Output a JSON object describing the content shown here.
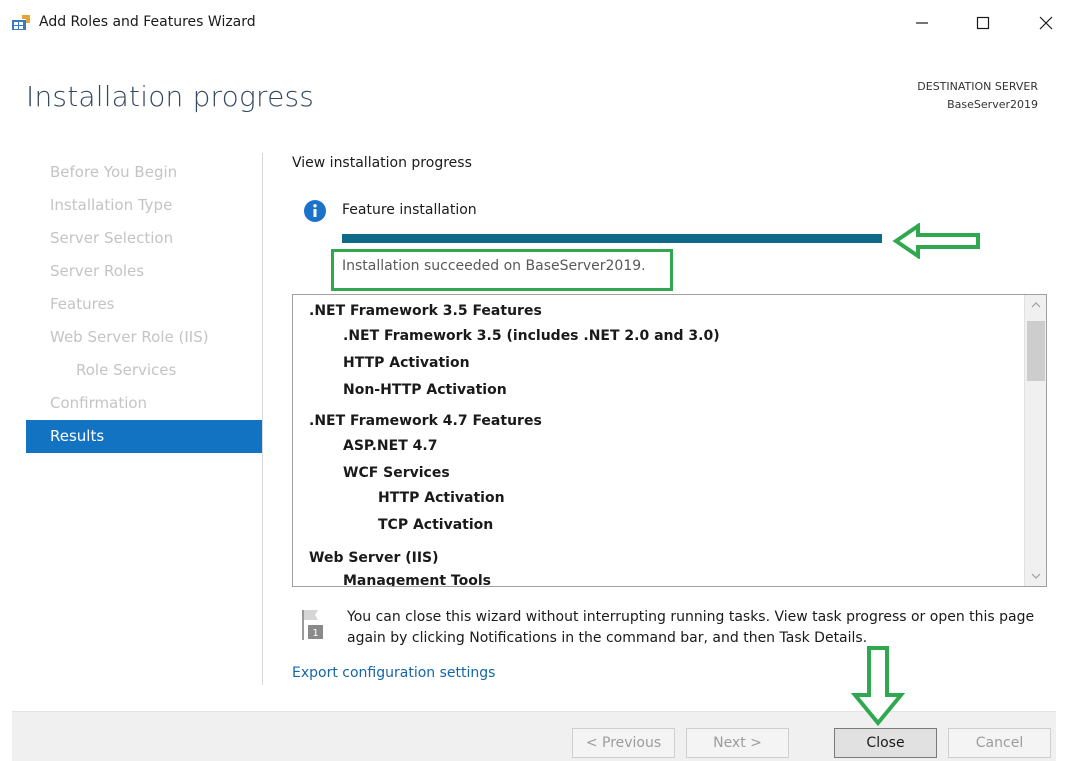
{
  "window": {
    "title": "Add Roles and Features Wizard"
  },
  "header": {
    "page_title": "Installation progress",
    "destination_label": "DESTINATION SERVER",
    "destination_server": "BaseServer2019"
  },
  "nav": {
    "items": [
      {
        "label": "Before You Begin",
        "state": "disabled"
      },
      {
        "label": "Installation Type",
        "state": "disabled"
      },
      {
        "label": "Server Selection",
        "state": "disabled"
      },
      {
        "label": "Server Roles",
        "state": "disabled"
      },
      {
        "label": "Features",
        "state": "disabled"
      },
      {
        "label": "Web Server Role (IIS)",
        "state": "disabled"
      },
      {
        "label": "Role Services",
        "state": "disabled"
      },
      {
        "label": "Confirmation",
        "state": "disabled"
      },
      {
        "label": "Results",
        "state": "active"
      }
    ]
  },
  "main": {
    "section_label": "View installation progress",
    "feature_title": "Feature installation",
    "progress": 1.0,
    "status": "Installation succeeded on BaseServer2019.",
    "features": [
      ".NET Framework 3.5 Features",
      ".NET Framework 3.5 (includes .NET 2.0 and 3.0)",
      "HTTP Activation",
      "Non-HTTP Activation",
      ".NET Framework 4.7 Features",
      "ASP.NET 4.7",
      "WCF Services",
      "HTTP Activation",
      "TCP Activation",
      "Web Server (IIS)",
      "Management Tools"
    ],
    "note": "You can close this wizard without interrupting running tasks. View task progress or open this page again by clicking Notifications in the command bar, and then Task Details.",
    "export_link": "Export configuration settings"
  },
  "footer": {
    "previous": "< Previous",
    "next": "Next >",
    "close": "Close",
    "cancel": "Cancel"
  },
  "colors": {
    "accent": "#1173c2",
    "progress": "#0f6a8a",
    "annotation": "#2fa84f",
    "title": "#34495e"
  },
  "icons": {
    "app": "server-manager-icon",
    "info": "info-icon",
    "flag": "notification-flag-icon"
  }
}
